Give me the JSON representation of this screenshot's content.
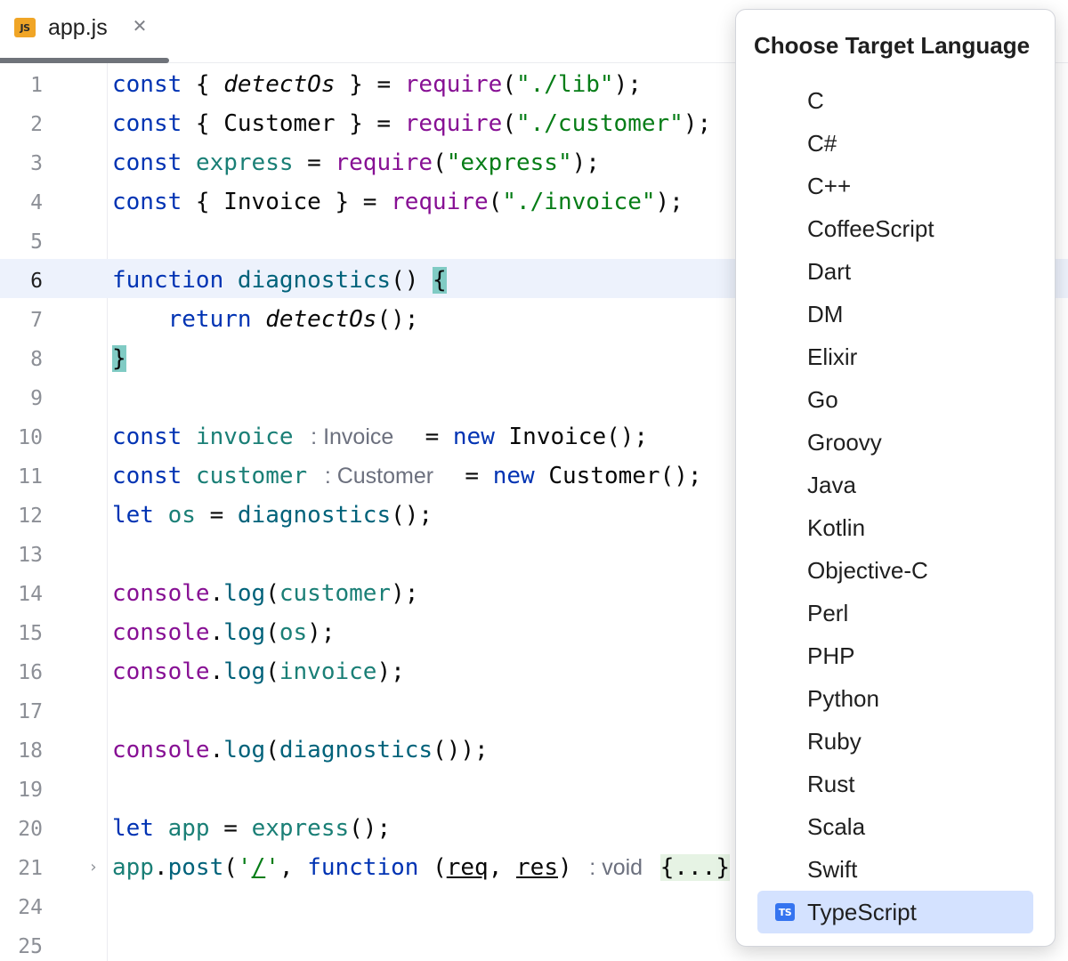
{
  "tab": {
    "icon_text": "JS",
    "icon_name": "javascript-file-icon",
    "title": "app.js",
    "close_glyph": "✕"
  },
  "editor": {
    "fold_glyph": "›",
    "lines": [
      {
        "num": "1"
      },
      {
        "num": "2"
      },
      {
        "num": "3"
      },
      {
        "num": "4"
      },
      {
        "num": "5"
      },
      {
        "num": "6"
      },
      {
        "num": "7"
      },
      {
        "num": "8"
      },
      {
        "num": "9"
      },
      {
        "num": "10"
      },
      {
        "num": "11"
      },
      {
        "num": "12"
      },
      {
        "num": "13"
      },
      {
        "num": "14"
      },
      {
        "num": "15"
      },
      {
        "num": "16"
      },
      {
        "num": "17"
      },
      {
        "num": "18"
      },
      {
        "num": "19"
      },
      {
        "num": "20"
      },
      {
        "num": "21"
      },
      {
        "num": "24"
      },
      {
        "num": "25"
      }
    ],
    "hints": {
      "invoice_type": ": Invoice",
      "customer_type": ": Customer",
      "post_return_type": ": void"
    }
  },
  "popup": {
    "title": "Choose Target Language",
    "languages": [
      {
        "label": "C"
      },
      {
        "label": "C#"
      },
      {
        "label": "C++"
      },
      {
        "label": "CoffeeScript"
      },
      {
        "label": "Dart"
      },
      {
        "label": "DM"
      },
      {
        "label": "Elixir"
      },
      {
        "label": "Go"
      },
      {
        "label": "Groovy"
      },
      {
        "label": "Java"
      },
      {
        "label": "Kotlin"
      },
      {
        "label": "Objective-C"
      },
      {
        "label": "Perl"
      },
      {
        "label": "PHP"
      },
      {
        "label": "Python"
      },
      {
        "label": "Ruby"
      },
      {
        "label": "Rust"
      },
      {
        "label": "Scala"
      },
      {
        "label": "Swift"
      },
      {
        "label": "TypeScript",
        "selected": true,
        "icon_text": "TS",
        "icon_name": "typescript-file-icon"
      }
    ]
  },
  "colors": {
    "keyword": "#0033b3",
    "string": "#067d17",
    "function": "#00627a",
    "variable": "#1a7f76",
    "global": "#871094",
    "selection": "#d4e2ff",
    "current_line": "#edf2fc"
  }
}
